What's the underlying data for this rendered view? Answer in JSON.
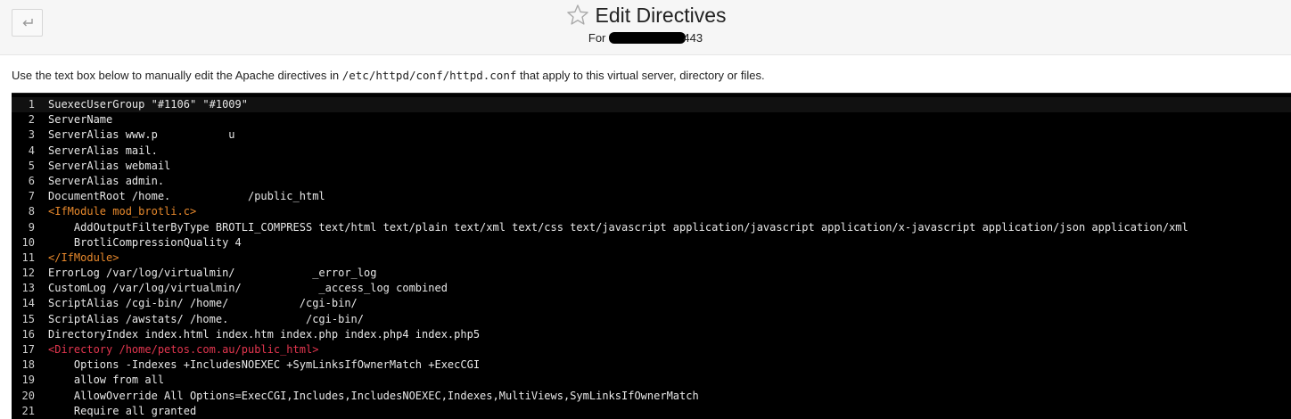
{
  "header": {
    "title": "Edit Directives",
    "subtitle_prefix": "For",
    "subtitle_suffix": "443"
  },
  "description": {
    "before": "Use the text box below to manually edit the Apache directives in ",
    "path": "/etc/httpd/conf/httpd.conf",
    "after": " that apply to this virtual server, directory or files."
  },
  "icons": {
    "back": "back-arrow-icon",
    "star": "star-icon"
  },
  "colors": {
    "editor_bg": "#000000",
    "module_tag": "#e8892c",
    "directory_tag": "#e3364f"
  },
  "editor": {
    "lines": [
      {
        "n": "1",
        "text": "SuexecUserGroup \"#1106\" \"#1009\"",
        "style": ""
      },
      {
        "n": "2",
        "text": "ServerName",
        "style": ""
      },
      {
        "n": "3",
        "text": "ServerAlias www.p           u",
        "style": ""
      },
      {
        "n": "4",
        "text": "ServerAlias mail.",
        "style": ""
      },
      {
        "n": "5",
        "text": "ServerAlias webmail",
        "style": ""
      },
      {
        "n": "6",
        "text": "ServerAlias admin.",
        "style": ""
      },
      {
        "n": "7",
        "text": "DocumentRoot /home.            /public_html",
        "style": ""
      },
      {
        "n": "8",
        "text": "<IfModule mod_brotli.c>",
        "style": "orange"
      },
      {
        "n": "9",
        "text": "    AddOutputFilterByType BROTLI_COMPRESS text/html text/plain text/xml text/css text/javascript application/javascript application/x-javascript application/json application/xml",
        "style": ""
      },
      {
        "n": "10",
        "text": "    BrotliCompressionQuality 4",
        "style": ""
      },
      {
        "n": "11",
        "text": "</IfModule>",
        "style": "orange"
      },
      {
        "n": "12",
        "text": "ErrorLog /var/log/virtualmin/            _error_log",
        "style": ""
      },
      {
        "n": "13",
        "text": "CustomLog /var/log/virtualmin/            _access_log combined",
        "style": ""
      },
      {
        "n": "14",
        "text": "ScriptAlias /cgi-bin/ /home/           /cgi-bin/",
        "style": ""
      },
      {
        "n": "15",
        "text": "ScriptAlias /awstats/ /home.            /cgi-bin/",
        "style": ""
      },
      {
        "n": "16",
        "text": "DirectoryIndex index.html index.htm index.php index.php4 index.php5",
        "style": ""
      },
      {
        "n": "17",
        "text": "<Directory /home/petos.com.au/public_html>",
        "style": "red"
      },
      {
        "n": "18",
        "text": "    Options -Indexes +IncludesNOEXEC +SymLinksIfOwnerMatch +ExecCGI",
        "style": ""
      },
      {
        "n": "19",
        "text": "    allow from all",
        "style": ""
      },
      {
        "n": "20",
        "text": "    AllowOverride All Options=ExecCGI,Includes,IncludesNOEXEC,Indexes,MultiViews,SymLinksIfOwnerMatch",
        "style": ""
      },
      {
        "n": "21",
        "text": "    Require all granted",
        "style": ""
      }
    ]
  }
}
